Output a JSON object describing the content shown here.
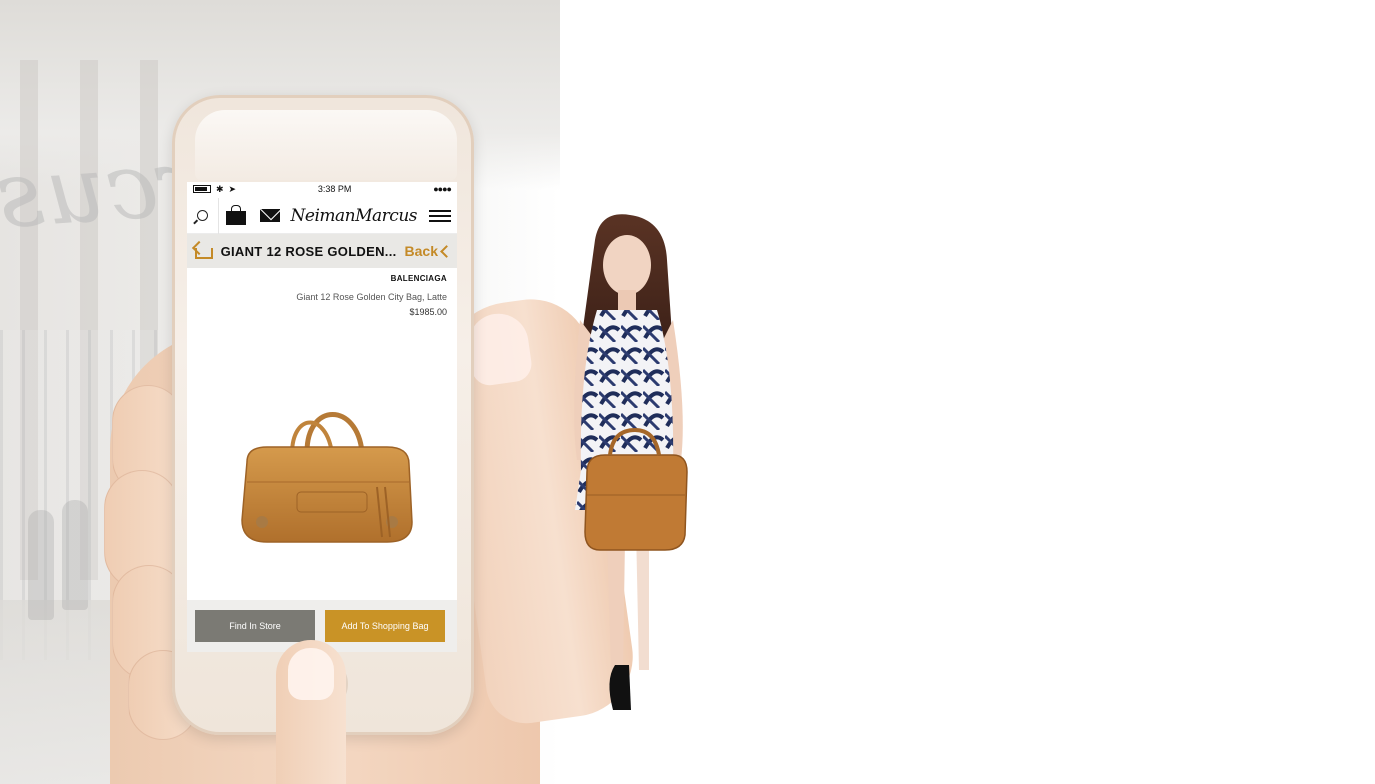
{
  "status_bar": {
    "time": "3:38 PM",
    "signal": "●●●●"
  },
  "header": {
    "brand": "NeimanMarcus"
  },
  "nav": {
    "title": "GIANT 12 ROSE GOLDEN...",
    "back_label": "Back"
  },
  "product": {
    "designer": "BALENCIAGA",
    "name": "Giant 12 Rose Golden City Bag, Latte",
    "price": "$1985.00"
  },
  "buttons": {
    "find_in_store": "Find In Store",
    "add_to_bag": "Add To Shopping Bag"
  },
  "background": {
    "store_sign": "Marcus"
  },
  "colors": {
    "accent": "#c99326",
    "secondary_button": "#7b7a74",
    "nav_background": "#e9e8e5"
  },
  "icons": {
    "search": "search-icon",
    "bag": "shopping-bag-icon",
    "mail": "envelope-icon",
    "menu": "hamburger-menu-icon",
    "share": "share-icon",
    "back": "chevron-left-icon"
  }
}
